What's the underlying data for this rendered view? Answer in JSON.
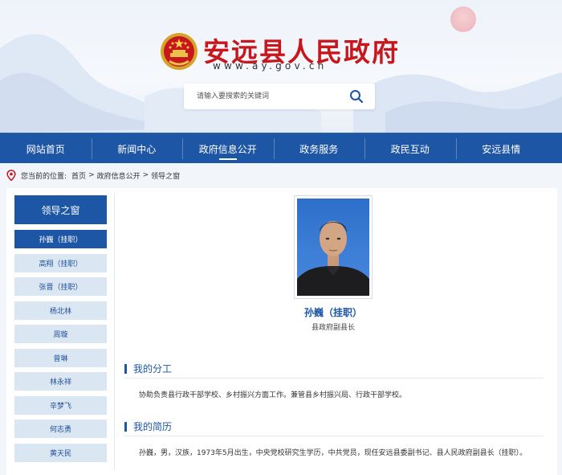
{
  "header": {
    "site_title": "安远县人民政府",
    "site_url": "www.ay.gov.cn",
    "search_placeholder": "请输入要搜索的关键词",
    "title_color": "#c8161d"
  },
  "nav": {
    "items": [
      "网站首页",
      "新闻中心",
      "政府信息公开",
      "政务服务",
      "政民互动",
      "安远县情"
    ],
    "active_index": 2,
    "color": "#1e56a6"
  },
  "breadcrumb": {
    "prefix": "您当前的位置:",
    "items": [
      "首页",
      "政府信息公开",
      "领导之窗"
    ],
    "separator": ">"
  },
  "sidebar": {
    "title": "领导之窗",
    "items": [
      "孙巍（挂职）",
      "高翔（挂职）",
      "张晋（挂职）",
      "杨北林",
      "周璇",
      "曾琳",
      "林永祥",
      "辛梦飞",
      "何志勇",
      "黄天民"
    ],
    "active_index": 0
  },
  "profile": {
    "name": "孙巍（挂职）",
    "position": "县政府副县长"
  },
  "sections": {
    "duty_heading": "我的分工",
    "duty_text": "协助负责县行政干部学校、乡村振兴方面工作。兼管县乡村振兴局、行政干部学校。",
    "resume_heading": "我的简历",
    "resume_text": "孙巍，男，汉族，1973年5月出生，中央党校研究生学历，中共党员，现任安远县委副书记、县人民政府副县长（挂职）。"
  }
}
